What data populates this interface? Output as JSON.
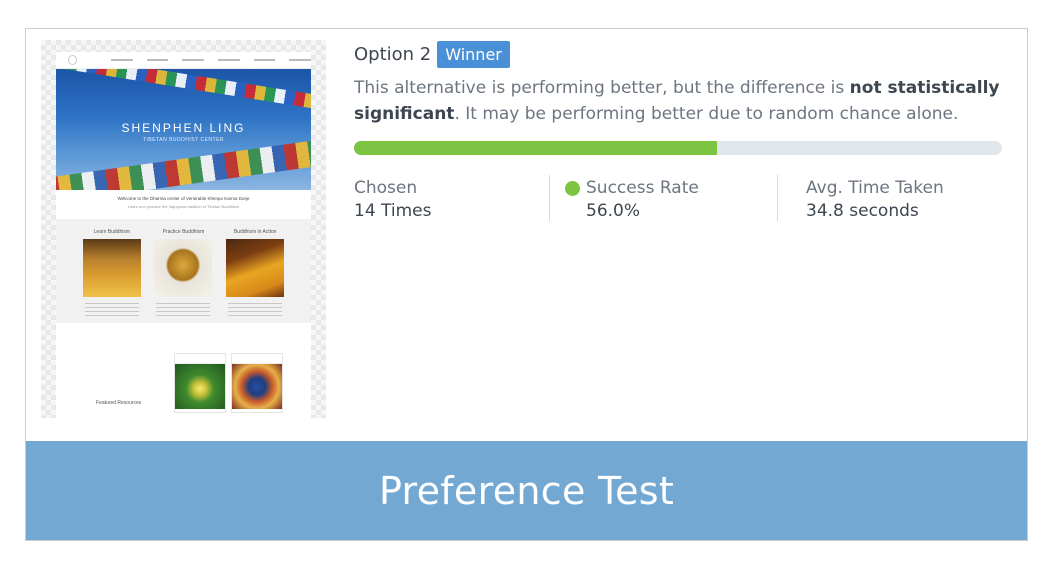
{
  "option": {
    "label": "Option 2",
    "badge": "Winner"
  },
  "description": {
    "part1": "This alternative is performing better, but the difference is ",
    "bold": "not statistically significant",
    "part2": ". It may be performing better due to random chance alone."
  },
  "progress": {
    "percent": 56.0,
    "fill_color": "#7dc443",
    "track_color": "#e1e6eb"
  },
  "stats": [
    {
      "label": "Chosen",
      "value": "14 Times"
    },
    {
      "label": "Success Rate",
      "value": "56.0%",
      "icon": "green-dot-icon"
    },
    {
      "label": "Avg. Time Taken",
      "value": "34.8 seconds"
    }
  ],
  "thumbnail": {
    "hero_title": "SHENPHEN LING",
    "hero_subtitle": "TIBETAN BUDDHIST CENTER",
    "welcome_line1": "Welcome to the Dharma center of Venerable Khenpo Karma Dorje",
    "welcome_line2": "Learn and practice the Vajrayana tradition of Tibetan Buddhism",
    "columns": [
      "Learn Buddhism",
      "Practice Buddhism",
      "Buddhism in Action"
    ],
    "featured_label": "Featured Resources"
  },
  "banner": {
    "title": "Preference Test",
    "color": "#73a8d3"
  }
}
